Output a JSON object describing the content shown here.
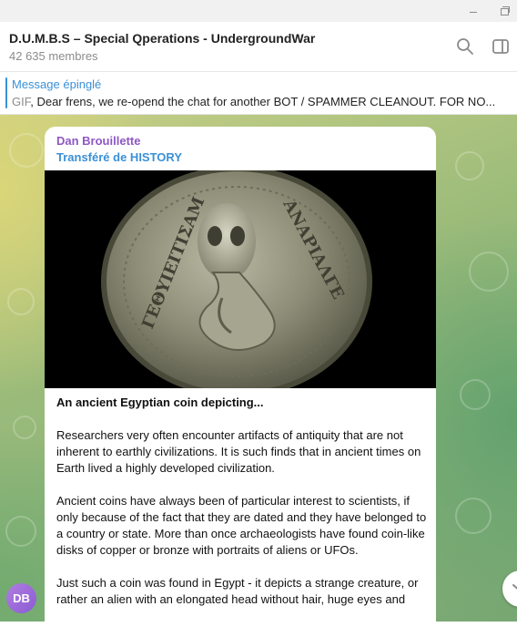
{
  "window": {
    "minimize_icon": "minimize-icon",
    "maximize_icon": "restore-icon"
  },
  "header": {
    "title": "D.U.M.B.S – Special Qperations - UndergroundWar",
    "members": "42 635 membres",
    "search_icon": "search-icon",
    "panel_icon": "side-panel-icon"
  },
  "pinned": {
    "label": "Message épinglé",
    "gif_label": "GIF",
    "text": ", Dear frens, we re-opend the chat for another BOT / SPAMMER CLEANOUT.  FOR NO..."
  },
  "message": {
    "sender": "Dan Brouillette",
    "forwarded": "Transféré de HISTORY",
    "coin_left_text": "ΓΕΘΥΙΕΙΤΙΣΑΜ",
    "coin_right_text": "ΑΝΑΡΙΑΛΓΕ",
    "heading": "An ancient Egyptian coin depicting...",
    "para1": "Researchers very often encounter artifacts of antiquity that are not inherent to earthly civilizations. It is such finds that in ancient times on Earth lived a highly developed civilization.",
    "para2": "Ancient coins have always been of particular interest to scientists, if only because of the fact that they are dated and they have belonged to a country or state. More than once archaeologists have found coin-like disks of copper or bronze with portraits of aliens or UFOs.",
    "para3": "Just such a coin was found in Egypt - it depicts a strange creature, or rather an alien with an elongated head without hair, huge eyes and"
  },
  "avatar": {
    "initials": "DB"
  },
  "colors": {
    "accent": "#3a90d6",
    "sender": "#8f57c6"
  }
}
